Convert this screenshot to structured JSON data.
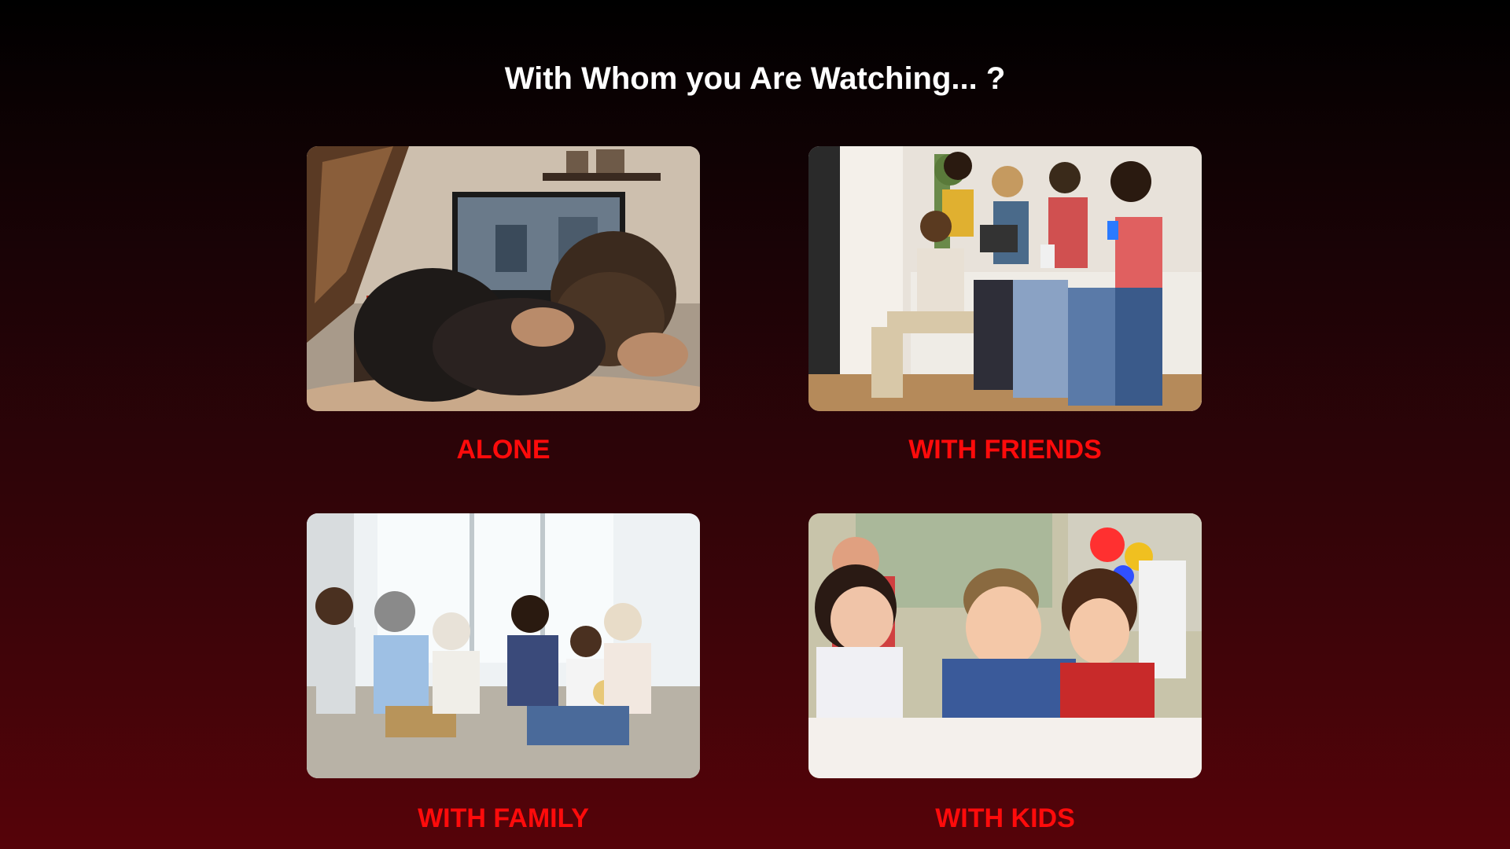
{
  "page": {
    "title": "With Whom you Are Watching... ?",
    "background_top": "#000000",
    "background_bottom": "#560309",
    "label_color": "#ff0b0b"
  },
  "options": [
    {
      "label": "ALONE",
      "image": "person-watching-tv-alone-photo"
    },
    {
      "label": "WITH FRIENDS",
      "image": "friends-on-couch-photo"
    },
    {
      "label": "WITH FAMILY",
      "image": "family-watching-tv-photo"
    },
    {
      "label": "WITH KIDS",
      "image": "kids-watching-photo"
    }
  ]
}
